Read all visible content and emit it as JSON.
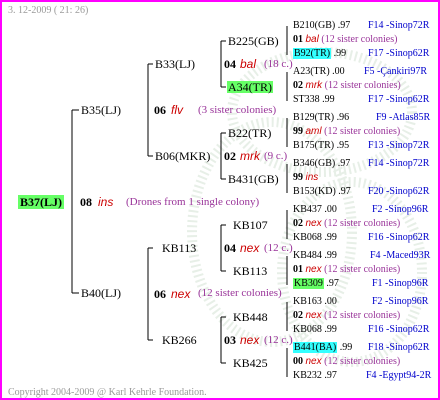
{
  "header": {
    "date": "3. 12-2009 ( 21: 26)"
  },
  "footer": {
    "copyright": "Copyright 2004-2009 @ Karl Kehrle Foundation."
  },
  "root": {
    "code": "B37(LJ)",
    "gen": "08",
    "type": "ins",
    "note": "(Drones from 1 single colony)"
  },
  "level1": [
    {
      "code": "B35(LJ)",
      "gen": "06",
      "type": "flv",
      "note": "(3 sister colonies)"
    },
    {
      "code": "B40(LJ)",
      "gen": "06",
      "type": "nex",
      "note": "(12 sister colonies)"
    }
  ],
  "level2": [
    {
      "code": "B33(LJ)",
      "gen": "04",
      "type": "bal",
      "note": "(18 c.)"
    },
    {
      "code": "B06(MKR)",
      "gen": "02",
      "type": "mrk",
      "note": "(9 c.)"
    },
    {
      "code": "KB113",
      "gen": "04",
      "type": "nex",
      "note": "(12 c.)"
    },
    {
      "code": "KB266",
      "gen": "03",
      "type": "nex",
      "note": "(12 c.)"
    }
  ],
  "level3": [
    {
      "code": "B225(GB)",
      "hl": ""
    },
    {
      "code": "A34(TR)",
      "hl": "green"
    },
    {
      "code": "B22(TR)",
      "hl": ""
    },
    {
      "code": "B431(GB)",
      "hl": ""
    },
    {
      "code": "KB107",
      "hl": ""
    },
    {
      "code": "KB113",
      "hl": ""
    },
    {
      "code": "KB448",
      "hl": ""
    },
    {
      "code": "KB425",
      "hl": ""
    }
  ],
  "level4": [
    {
      "a": "B210(GB)",
      "a_hl": "",
      "av": ".97",
      "b": "F14 -Sinop72R"
    },
    {
      "gen": "01",
      "type": "bal",
      "note": "(12 sister colonies)"
    },
    {
      "a": "B92(TR)",
      "a_hl": "cyan",
      "av": ".99",
      "b": "F17 -Sinop62R"
    },
    {
      "a": "A23(TR)",
      "a_hl": "",
      "av": ".00",
      "b": "F5 -Çankiri97R"
    },
    {
      "gen": "02",
      "type": "mrk",
      "note": "(12 sister colonies)"
    },
    {
      "a": "ST338",
      "a_hl": "",
      "av": ".99",
      "b": "F17 -Sinop62R"
    },
    {
      "a": "B129(TR)",
      "a_hl": "",
      "av": ".96",
      "b": "F9 -Atlas85R"
    },
    {
      "gen": "99",
      "type": "aml",
      "note": "(12 sister colonies)"
    },
    {
      "a": "B175(TR)",
      "a_hl": "",
      "av": ".95",
      "b": "F13 -Sinop72R"
    },
    {
      "a": "B346(GB)",
      "a_hl": "",
      "av": ".97",
      "b": "F14 -Sinop72R"
    },
    {
      "gen": "99",
      "type": "ins",
      "note": ""
    },
    {
      "a": "B153(KD)",
      "a_hl": "",
      "av": ".97",
      "b": "F20 -Sinop62R"
    },
    {
      "a": "KB437",
      "a_hl": "",
      "av": ".00",
      "b": "F2 -Sinop96R"
    },
    {
      "gen": "02",
      "type": "nex",
      "note": "(12 sister colonies)"
    },
    {
      "a": "KB068",
      "a_hl": "",
      "av": ".99",
      "b": "F16 -Sinop62R"
    },
    {
      "a": "KB484",
      "a_hl": "",
      "av": ".99",
      "b": "F4 -Maced93R"
    },
    {
      "gen": "01",
      "type": "nex",
      "note": "(12 sister colonies)"
    },
    {
      "a": "KB309",
      "a_hl": "green",
      "av": ".97",
      "b": "F1 -Sinop96R"
    },
    {
      "a": "KB163",
      "a_hl": "",
      "av": ".00",
      "b": "F2 -Sinop96R"
    },
    {
      "gen": "02",
      "type": "nex",
      "note": "(12 sister colonies)"
    },
    {
      "a": "KB068",
      "a_hl": "",
      "av": ".99",
      "b": "F16 -Sinop62R"
    },
    {
      "a": "B441(BA)",
      "a_hl": "cyan",
      "av": ".99",
      "b": "F18 -Sinop62R"
    },
    {
      "gen": "00",
      "type": "nex",
      "note": "(12 sister colonies)"
    },
    {
      "a": "KB232",
      "a_hl": "",
      "av": ".97",
      "b": "F4 -Egypt94-2R"
    }
  ]
}
